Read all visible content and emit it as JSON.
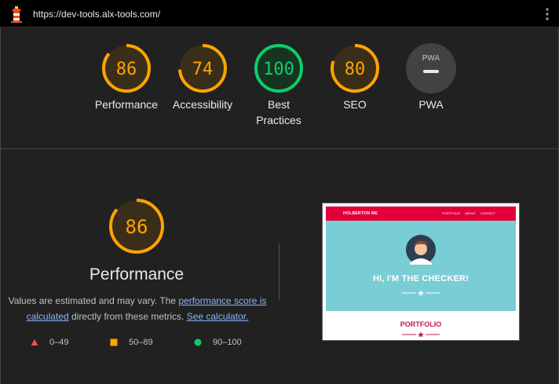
{
  "header": {
    "url": "https://dev-tools.alx-tools.com/"
  },
  "gauges": [
    {
      "score": "86",
      "label_line1": "Performance",
      "label_line2": "",
      "color": "#ffa400",
      "fraction": 0.86
    },
    {
      "score": "74",
      "label_line1": "Accessibility",
      "label_line2": "",
      "color": "#ffa400",
      "fraction": 0.74
    },
    {
      "score": "100",
      "label_line1": "Best",
      "label_line2": "Practices",
      "color": "#0cce6b",
      "fraction": 1.0
    },
    {
      "score": "80",
      "label_line1": "SEO",
      "label_line2": "",
      "color": "#ffa400",
      "fraction": 0.8
    },
    {
      "score": "",
      "label_line1": "PWA",
      "label_line2": "",
      "color": "#9aa0a6",
      "badge_text": "PWA"
    }
  ],
  "performance": {
    "score": "86",
    "fraction": 0.86,
    "color": "#ffa400",
    "title": "Performance",
    "desc_part1": "Values are estimated and may vary. The ",
    "desc_link1": "performance score is calculated",
    "desc_part2": " directly from these metrics. ",
    "desc_link2": "See calculator."
  },
  "legend": {
    "fail": {
      "range": "0–49",
      "color": "#ff4e42",
      "icon": "triangle-icon"
    },
    "average": {
      "range": "50–89",
      "color": "#ffa400",
      "icon": "square-icon"
    },
    "pass": {
      "range": "90–100",
      "color": "#0cce6b",
      "icon": "circle-icon"
    }
  },
  "screenshot": {
    "brand": "HOLBERTON ME",
    "nav_links": [
      "PORTFOLIO",
      "ABOUT",
      "CONTACT"
    ],
    "hero_title": "HI, I'M THE CHECKER!",
    "section_title": "PORTFOLIO"
  }
}
